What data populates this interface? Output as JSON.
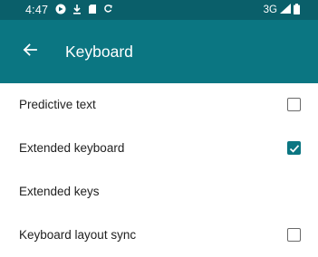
{
  "status_bar": {
    "time": "4:47",
    "network": "3G",
    "icons": [
      "notification-icon",
      "download-icon",
      "sd-card-icon",
      "sync-icon",
      "signal-icon",
      "battery-icon"
    ]
  },
  "app_bar": {
    "title": "Keyboard",
    "back_icon": "arrow-left-icon"
  },
  "colors": {
    "status_bar": "#0a5f6a",
    "app_bar": "#0b7682",
    "accent": "#0b7682"
  },
  "settings": [
    {
      "label": "Predictive text",
      "control": "checkbox",
      "checked": false
    },
    {
      "label": "Extended keyboard",
      "control": "checkbox",
      "checked": true
    },
    {
      "label": "Extended keys",
      "control": "none"
    },
    {
      "label": "Keyboard layout sync",
      "control": "checkbox",
      "checked": false
    }
  ]
}
